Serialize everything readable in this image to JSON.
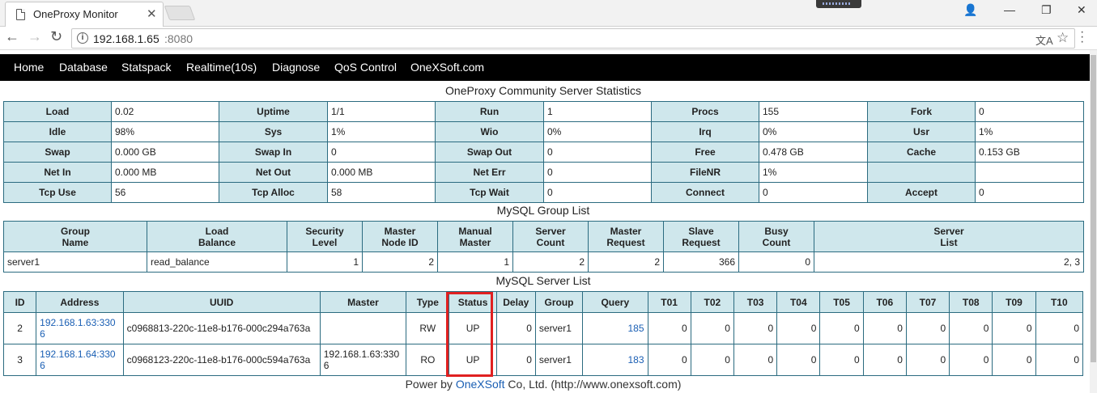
{
  "browser": {
    "tab_title": "OneProxy Monitor",
    "url_host": "192.168.1.65",
    "url_port": ":8080"
  },
  "nav": [
    "Home",
    "Database",
    "Statspack",
    "Realtime(10s)",
    "Diagnose",
    "QoS Control",
    "OneXSoft.com"
  ],
  "stats": {
    "title": "OneProxy Community Server Statistics",
    "rows": [
      [
        [
          "Load",
          "0.02"
        ],
        [
          "Uptime",
          "1/1"
        ],
        [
          "Run",
          "1"
        ],
        [
          "Procs",
          "155"
        ],
        [
          "Fork",
          "0"
        ]
      ],
      [
        [
          "Idle",
          "98%"
        ],
        [
          "Sys",
          "1%"
        ],
        [
          "Wio",
          "0%"
        ],
        [
          "Irq",
          "0%"
        ],
        [
          "Usr",
          "1%"
        ]
      ],
      [
        [
          "Swap",
          "0.000 GB"
        ],
        [
          "Swap In",
          "0"
        ],
        [
          "Swap Out",
          "0"
        ],
        [
          "Free",
          "0.478 GB"
        ],
        [
          "Cache",
          "0.153 GB"
        ]
      ],
      [
        [
          "Net In",
          "0.000 MB"
        ],
        [
          "Net Out",
          "0.000 MB"
        ],
        [
          "Net Err",
          "0"
        ],
        [
          "FileNR",
          "1%"
        ],
        [
          "",
          ""
        ]
      ],
      [
        [
          "Tcp Use",
          "56"
        ],
        [
          "Tcp Alloc",
          "58"
        ],
        [
          "Tcp Wait",
          "0"
        ],
        [
          "Connect",
          "0"
        ],
        [
          "Accept",
          "0"
        ]
      ]
    ]
  },
  "groups": {
    "title": "MySQL Group List",
    "headers": [
      [
        "Group",
        "Name"
      ],
      [
        "Load",
        "Balance"
      ],
      [
        "Security",
        "Level"
      ],
      [
        "Master",
        "Node ID"
      ],
      [
        "Manual",
        "Master"
      ],
      [
        "Server",
        "Count"
      ],
      [
        "Master",
        "Request"
      ],
      [
        "Slave",
        "Request"
      ],
      [
        "Busy",
        "Count"
      ],
      [
        "Server",
        "List"
      ]
    ],
    "rows": [
      [
        "server1",
        "read_balance",
        "1",
        "2",
        "1",
        "2",
        "2",
        "366",
        "0",
        "2, 3"
      ]
    ]
  },
  "servers": {
    "title": "MySQL Server List",
    "headers": [
      "ID",
      "Address",
      "UUID",
      "Master",
      "Type",
      "Status",
      "Delay",
      "Group",
      "Query",
      "T01",
      "T02",
      "T03",
      "T04",
      "T05",
      "T06",
      "T07",
      "T08",
      "T09",
      "T10"
    ],
    "rows": [
      [
        "2",
        "192.168.1.63:3306",
        "c0968813-220c-11e8-b176-000c294a763a",
        "",
        "RW",
        "UP",
        "0",
        "server1",
        "185",
        "0",
        "0",
        "0",
        "0",
        "0",
        "0",
        "0",
        "0",
        "0",
        "0"
      ],
      [
        "3",
        "192.168.1.64:3306",
        "c0968123-220c-11e8-b176-000c594a763a",
        "192.168.1.63:3306",
        "RO",
        "UP",
        "0",
        "server1",
        "183",
        "0",
        "0",
        "0",
        "0",
        "0",
        "0",
        "0",
        "0",
        "0",
        "0"
      ]
    ]
  },
  "footer": {
    "prefix": "Power by ",
    "brand": "OneXSoft",
    "suffix": " Co, Ltd. (http://www.onexsoft.com)"
  },
  "colors": {
    "header_bg": "#cfe7ec",
    "border": "#2b6b80",
    "link": "#1a5fb4",
    "highlight": "#e02020",
    "navbar": "#000000"
  }
}
